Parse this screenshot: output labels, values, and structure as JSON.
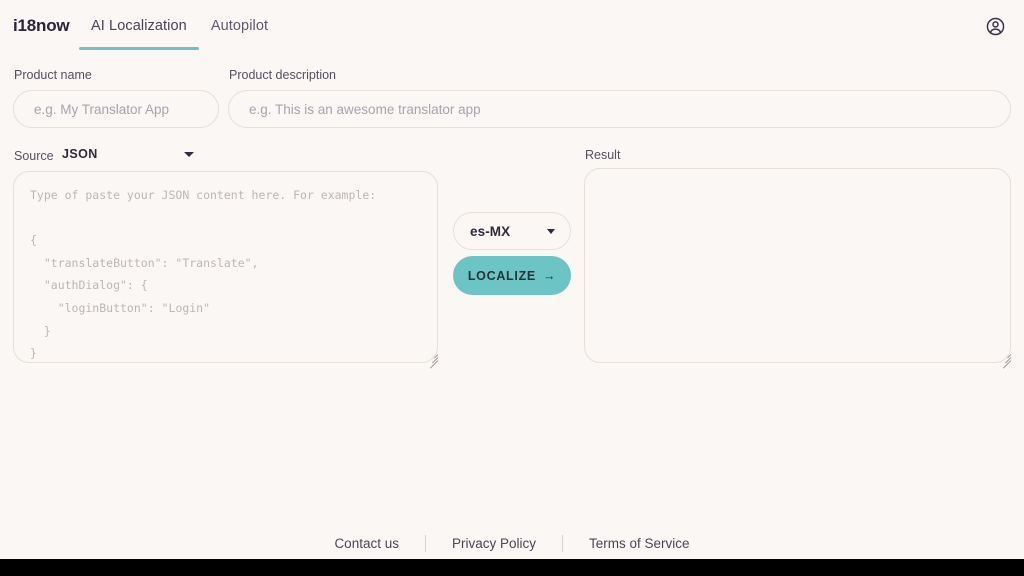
{
  "header": {
    "logo": "i18now",
    "tabs": [
      {
        "label": "AI Localization",
        "active": true
      },
      {
        "label": "Autopilot",
        "active": false
      }
    ],
    "account_icon": "account-circle-icon"
  },
  "form": {
    "product_name": {
      "label": "Product name",
      "value": "",
      "placeholder": "e.g. My Translator App"
    },
    "product_description": {
      "label": "Product description",
      "value": "",
      "placeholder": "e.g. This is an awesome translator app"
    }
  },
  "source": {
    "label": "Source",
    "selected": "JSON",
    "caret_icon": "chevron-down-icon",
    "textarea_value": "",
    "textarea_placeholder": "Type of paste your JSON content here. For example:\n\n{\n  \"translateButton\": \"Translate\",\n  \"authDialog\": {\n    \"loginButton\": \"Login\"\n  }\n}"
  },
  "controls": {
    "language_selected": "es-MX",
    "language_caret_icon": "chevron-down-icon",
    "localize_label": "LOCALIZE",
    "localize_arrow": "→"
  },
  "result": {
    "label": "Result",
    "value": "",
    "placeholder": ""
  },
  "footer": {
    "links": [
      {
        "label": "Contact us"
      },
      {
        "label": "Privacy Policy"
      },
      {
        "label": "Terms of Service"
      }
    ]
  },
  "colors": {
    "background": "#FAF7F4",
    "accent_teal": "#6CC4C4",
    "text_dark": "#2C2340",
    "border": "#E6DFDA",
    "placeholder": "#A9A3B0"
  }
}
